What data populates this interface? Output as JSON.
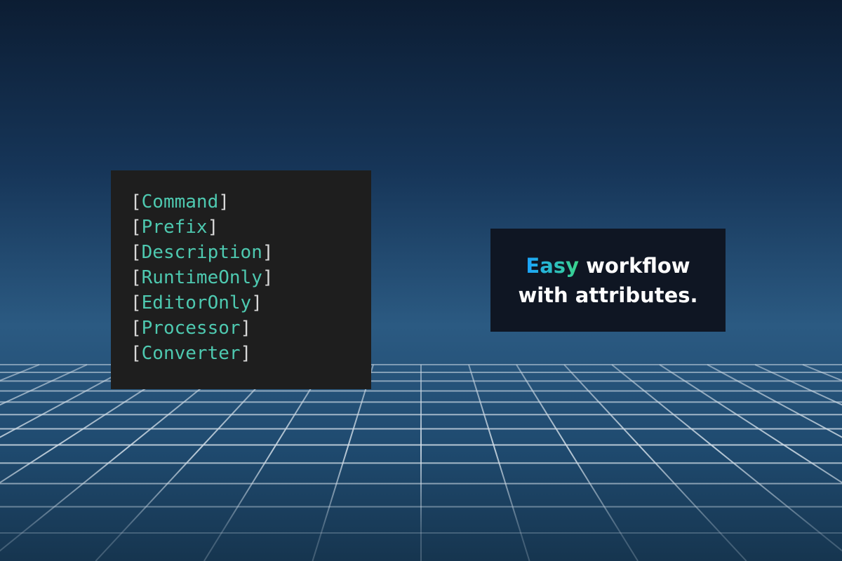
{
  "code_panel": {
    "attributes": [
      "Command",
      "Prefix",
      "Description",
      "RuntimeOnly",
      "EditorOnly",
      "Processor",
      "Converter"
    ],
    "bracket_open": "[",
    "bracket_close": "]"
  },
  "tagline": {
    "highlight": "Easy",
    "line1_rest": " workflow",
    "line2": "with attributes."
  },
  "colors": {
    "attribute_text": "#4ec9b0",
    "bracket_text": "#d8d8d8",
    "code_background": "#1e1e1e",
    "tagline_background": "#0f1623",
    "highlight_gradient_start": "#1aa3ff",
    "highlight_gradient_end": "#3bd58a",
    "grid_line": "#c8d6e2"
  }
}
